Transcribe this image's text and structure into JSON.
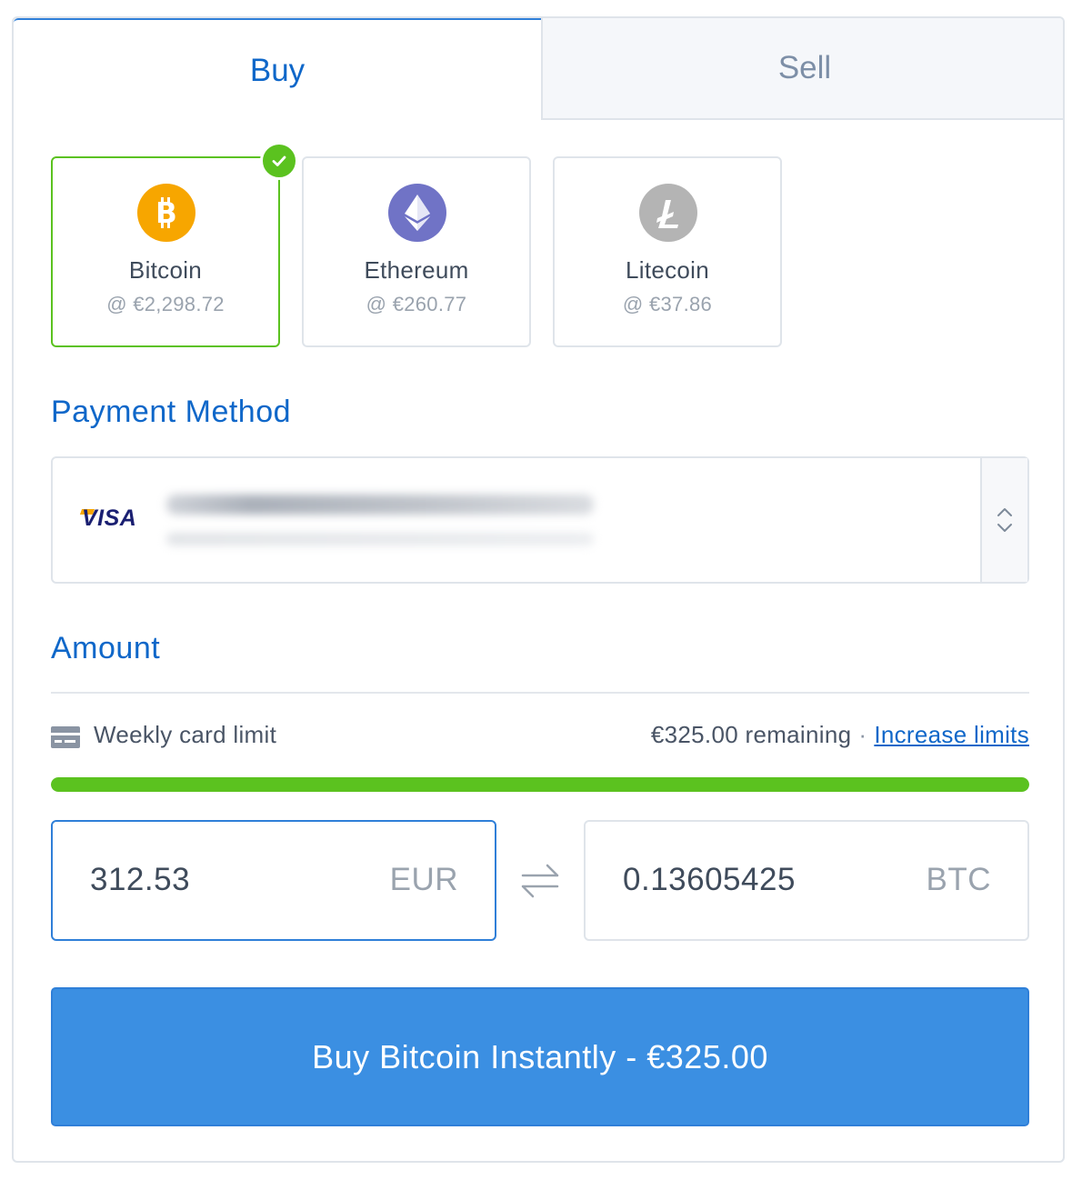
{
  "tabs": {
    "buy": "Buy",
    "sell": "Sell"
  },
  "coins": [
    {
      "name": "Bitcoin",
      "price": "@ €2,298.72",
      "icon": "bitcoin-icon",
      "color": "#f7a600",
      "selected": true
    },
    {
      "name": "Ethereum",
      "price": "@ €260.77",
      "icon": "ethereum-icon",
      "color": "#7073c6",
      "selected": false
    },
    {
      "name": "Litecoin",
      "price": "@ €37.86",
      "icon": "litecoin-icon",
      "color": "#b4b4b4",
      "selected": false
    }
  ],
  "payment": {
    "title": "Payment Method",
    "card_brand": "VISA"
  },
  "amount": {
    "title": "Amount",
    "limit_label": "Weekly card limit",
    "remaining": "€325.00 remaining",
    "separator": "·",
    "increase_link": "Increase limits",
    "limit_progress": 1.0,
    "fiat_value": "312.53",
    "fiat_currency": "EUR",
    "crypto_value": "0.13605425",
    "crypto_currency": "BTC"
  },
  "buy_button": "Buy Bitcoin Instantly - €325.00",
  "colors": {
    "accent": "#0f67c9",
    "button": "#3b8fe2",
    "success": "#5bc21f",
    "border": "#dfe4ea"
  }
}
